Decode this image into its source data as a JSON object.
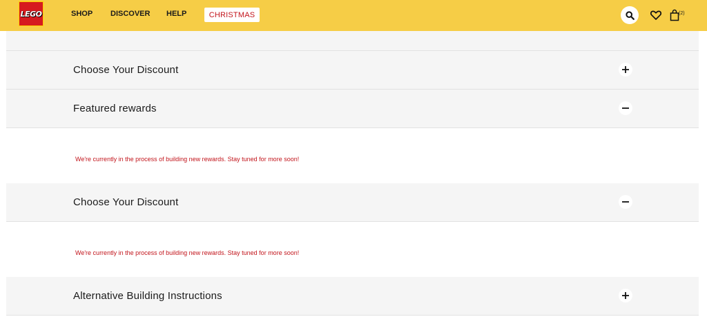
{
  "header": {
    "logo_text": "LEGO",
    "nav": [
      "SHOP",
      "DISCOVER",
      "HELP"
    ],
    "christmas_label": "CHRISTMAS",
    "bag_count": "(2)"
  },
  "sections": [
    {
      "title": "Choose Your Discount",
      "state": "collapsed",
      "toggle_icon": "plus-icon"
    },
    {
      "title": "Featured rewards",
      "state": "expanded",
      "toggle_icon": "minus-icon",
      "message": "We're currently in the process of building new rewards. Stay tuned for more soon!"
    },
    {
      "title": "Choose Your Discount",
      "state": "expanded",
      "toggle_icon": "minus-icon",
      "message": "We're currently in the process of building new rewards. Stay tuned for more soon!"
    },
    {
      "title": "Alternative Building Instructions",
      "state": "collapsed",
      "toggle_icon": "plus-icon"
    }
  ],
  "colors": {
    "header_bg": "#f6cd46",
    "accent_red": "#c2141b",
    "row_bg": "#f5f5f5"
  }
}
